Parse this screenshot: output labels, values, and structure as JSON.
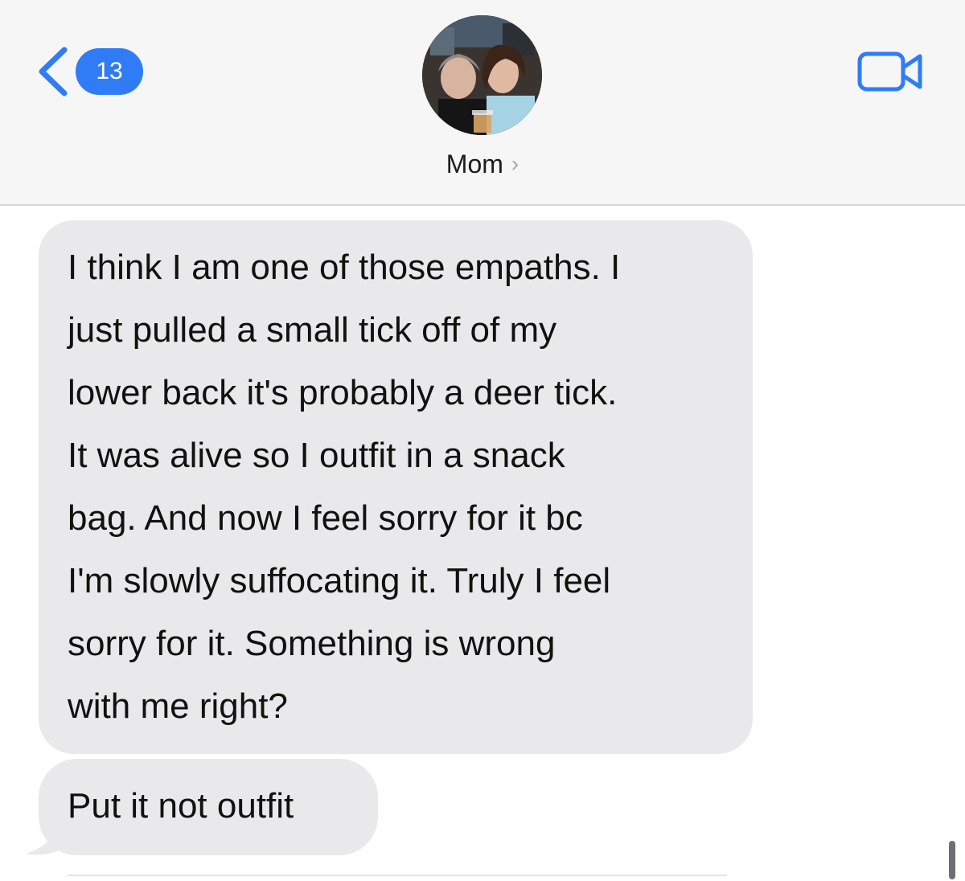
{
  "header": {
    "back_badge": "13",
    "contact_name": "Mom",
    "avatar_icon": "contact-photo",
    "video_icon": "video-camera-icon",
    "accent_color": "#2f7cf6"
  },
  "messages": [
    {
      "direction": "incoming",
      "lines": [
        "I think I am one of those empaths.  I",
        "just pulled a small tick off of my",
        "lower back it's probably a deer tick.",
        "It was alive so I outfit in a snack",
        "bag. And now I feel sorry for it bc",
        "I'm slowly suffocating it. Truly I feel",
        "sorry for it. Something is wrong",
        "with me right?"
      ]
    },
    {
      "direction": "incoming",
      "lines": [
        "Put it not outfit"
      ]
    }
  ]
}
